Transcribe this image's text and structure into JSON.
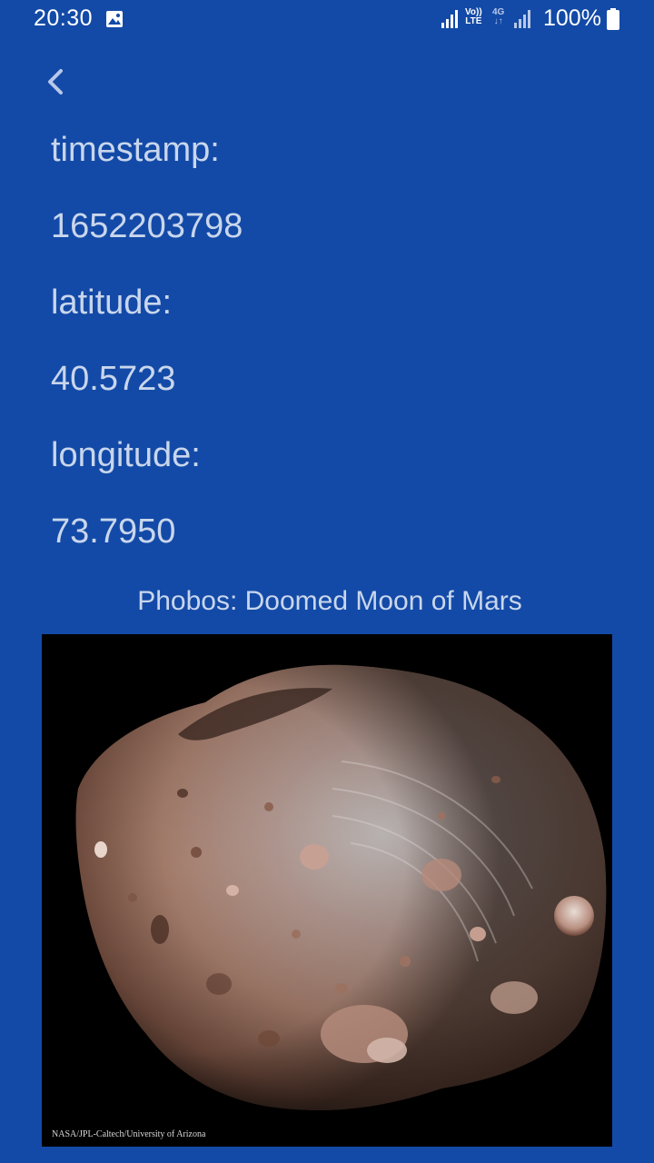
{
  "status_bar": {
    "time": "20:30",
    "volte_top": "Vo))",
    "volte_bottom": "LTE",
    "net_type": "4G",
    "battery_percent": "100%",
    "battery_level": 1.0
  },
  "info": {
    "timestamp_label": "timestamp:",
    "timestamp_value": "1652203798",
    "latitude_label": "latitude:",
    "latitude_value": "40.5723",
    "longitude_label": "longitude:",
    "longitude_value": "73.7950"
  },
  "apod": {
    "title": "Phobos: Doomed Moon of Mars",
    "credit": "NASA/JPL-Caltech/University of Arizona"
  }
}
